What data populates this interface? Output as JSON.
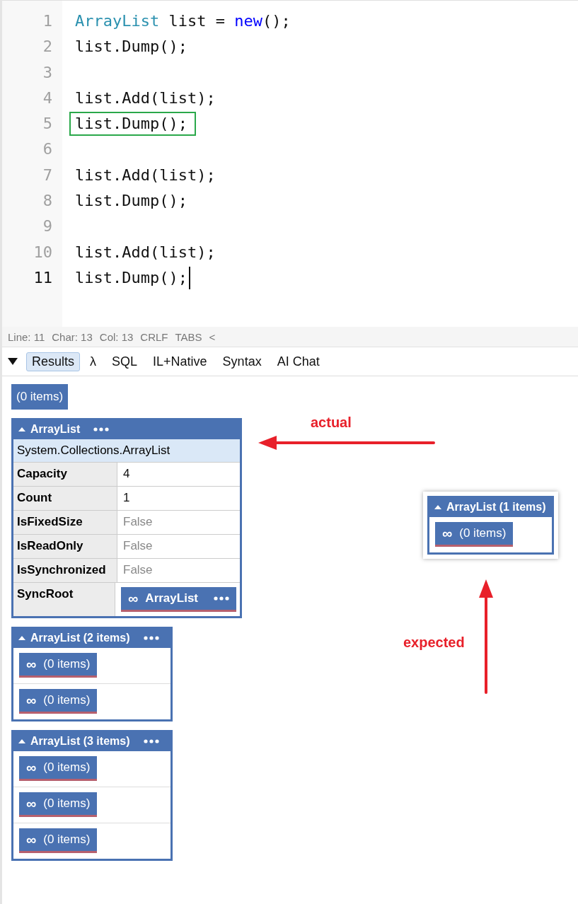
{
  "editor": {
    "lines": [
      {
        "number": "1",
        "current": false,
        "highlighted": false,
        "tokens": [
          {
            "kind": "type",
            "text": "ArrayList"
          },
          {
            "kind": "plain",
            "text": " list = "
          },
          {
            "kind": "keyword",
            "text": "new"
          },
          {
            "kind": "plain",
            "text": "();"
          }
        ]
      },
      {
        "number": "2",
        "current": false,
        "highlighted": false,
        "tokens": [
          {
            "kind": "plain",
            "text": "list.Dump();"
          }
        ]
      },
      {
        "number": "3",
        "current": false
      },
      {
        "number": "4",
        "current": false,
        "highlighted": false,
        "tokens": [
          {
            "kind": "plain",
            "text": "list.Add(list);"
          }
        ]
      },
      {
        "number": "5",
        "current": false,
        "highlighted": true,
        "tokens": [
          {
            "kind": "plain",
            "text": "list.Dump();"
          }
        ]
      },
      {
        "number": "6",
        "current": false
      },
      {
        "number": "7",
        "current": false,
        "highlighted": false,
        "tokens": [
          {
            "kind": "plain",
            "text": "list.Add(list);"
          }
        ]
      },
      {
        "number": "8",
        "current": false,
        "highlighted": false,
        "tokens": [
          {
            "kind": "plain",
            "text": "list.Dump();"
          }
        ]
      },
      {
        "number": "9",
        "current": false
      },
      {
        "number": "10",
        "current": false,
        "highlighted": false,
        "tokens": [
          {
            "kind": "plain",
            "text": "list.Add(list);"
          }
        ]
      },
      {
        "number": "11",
        "current": true,
        "highlighted": false,
        "tokens": [
          {
            "kind": "plain",
            "text": "list.Dump();"
          }
        ]
      }
    ]
  },
  "status_bar": [
    "Line: 11",
    "Char: 13",
    "Col: 13",
    "CRLF",
    "TABS",
    "<"
  ],
  "tabs": [
    {
      "label": "Results",
      "selected": true
    },
    {
      "label": "λ",
      "selected": false
    },
    {
      "label": "SQL",
      "selected": false
    },
    {
      "label": "IL+Native",
      "selected": false
    },
    {
      "label": "Syntax",
      "selected": false
    },
    {
      "label": "AI Chat",
      "selected": false
    }
  ],
  "results": [
    {
      "kind": "empty",
      "text": "(0 items)"
    },
    {
      "kind": "object",
      "title": "ArrayList",
      "expanded": true,
      "menu": true,
      "type_name": "System.Collections.ArrayList",
      "properties": [
        {
          "name": "Capacity",
          "value": "4",
          "kind": "value"
        },
        {
          "name": "Count",
          "value": "1",
          "kind": "value"
        },
        {
          "name": "IsFixedSize",
          "value": "False",
          "kind": "muted"
        },
        {
          "name": "IsReadOnly",
          "value": "False",
          "kind": "muted"
        },
        {
          "name": "IsSynchronized",
          "value": "False",
          "kind": "muted"
        },
        {
          "name": "SyncRoot",
          "value": "ArrayList",
          "kind": "reference",
          "icon": "∞"
        }
      ]
    },
    {
      "kind": "list",
      "title": "ArrayList (2 items)",
      "expanded": true,
      "menu": true,
      "items": [
        {
          "icon": "∞",
          "text": "(0 items)"
        },
        {
          "icon": "∞",
          "text": "(0 items)"
        }
      ]
    },
    {
      "kind": "list",
      "title": "ArrayList (3 items)",
      "expanded": true,
      "menu": true,
      "items": [
        {
          "icon": "∞",
          "text": "(0 items)"
        },
        {
          "icon": "∞",
          "text": "(0 items)"
        },
        {
          "icon": "∞",
          "text": "(0 items)"
        }
      ]
    }
  ],
  "annotations": {
    "actual_label": "actual",
    "expected_label": "expected",
    "expected": {
      "title": "ArrayList (1 items)",
      "expanded": true,
      "items": [
        {
          "icon": "∞",
          "text": "(0 items)"
        }
      ]
    }
  }
}
